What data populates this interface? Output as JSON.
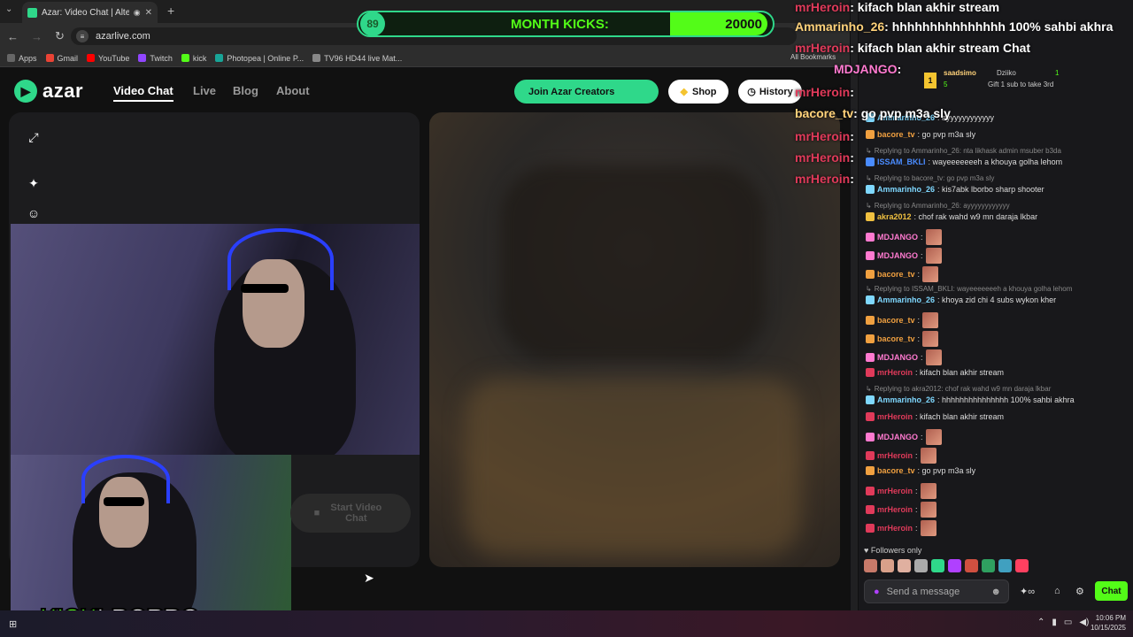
{
  "browser": {
    "tab_title": "Azar: Video Chat | Alternati",
    "url": "azarlive.com",
    "bookmarks": [
      {
        "label": "Apps",
        "color": "#666"
      },
      {
        "label": "Gmail",
        "color": "#ea4335"
      },
      {
        "label": "YouTube",
        "color": "#ff0000"
      },
      {
        "label": "Twitch",
        "color": "#9146ff"
      },
      {
        "label": "kick",
        "color": "#53fc18"
      },
      {
        "label": "Photopea | Online P...",
        "color": "#18a497"
      },
      {
        "label": "TV96 HD44 live Mat...",
        "color": "#888"
      }
    ],
    "all_bookmarks": "All Bookmarks",
    "window_caption": "gle Chrome"
  },
  "azar": {
    "logo": "azar",
    "nav": [
      "Video Chat",
      "Live",
      "Blog",
      "About"
    ],
    "join_creators": "Join Azar Creators",
    "shop": "Shop",
    "history": "History",
    "start_video_chat": "Start Video Chat"
  },
  "overlay": {
    "month_kicks_badge": "89",
    "month_kicks_label": "MONTH KICKS:",
    "month_kicks_value": "20000",
    "lines": [
      {
        "user": "mrHeroin",
        "text": ": kifach blan akhir stream"
      },
      {
        "user": "Ammarinho_26",
        "text": ": hhhhhhhhhhhhhhh 100% sahbi akhra"
      },
      {
        "user": "mrHeroin",
        "text": ": kifach blan akhir stream Chat"
      },
      {
        "user": "MDJANGO",
        "text": ":"
      },
      {
        "user": "mrHeroin",
        "text": ":"
      },
      {
        "user": "bacore_tv",
        "text": ": go pvp m3a sly"
      },
      {
        "user": "mrHeroin",
        "text": ":"
      },
      {
        "user": "mrHeroin",
        "text": ":"
      },
      {
        "user": "mrHeroin",
        "text": ":"
      }
    ]
  },
  "chat": {
    "gift": {
      "user": "saadsimo",
      "sub_count": "5",
      "other": "Dziiko",
      "other_count": "1",
      "caption": "Gift 1 sub to take 3rd",
      "rank": "1"
    },
    "messages": [
      {
        "reply": "",
        "user": "Ammarinho_26",
        "text": ": ayyyyyyyyyyyy",
        "color": "#7fd8ff"
      },
      {
        "reply": "",
        "user": "bacore_tv",
        "text": ": go pvp m3a sly",
        "color": "#f0a040"
      },
      {
        "reply": "Replying to Ammarinho_26: nta likhask admin msuber b3da",
        "user": "ISSAM_BKLI",
        "text": ": wayeeeeeeeh a khouya golha lehom",
        "color": "#4a8cff"
      },
      {
        "reply": "Replying to bacore_tv: go pvp m3a sly",
        "user": "Ammarinho_26",
        "text": ": kis7abk lborbo sharp shooter",
        "color": "#7fd8ff"
      },
      {
        "reply": "Replying to Ammarinho_26: ayyyyyyyyyyyy",
        "user": "akra2012",
        "text": ": chof rak wahd w9 mn daraja lkbar",
        "color": "#f0c040"
      },
      {
        "reply": "",
        "user": "MDJANGO",
        "text": ":",
        "color": "#ff7ad0"
      },
      {
        "reply": "",
        "user": "MDJANGO",
        "text": ":",
        "color": "#ff7ad0"
      },
      {
        "reply": "",
        "user": "bacore_tv",
        "text": ":",
        "color": "#f0a040"
      },
      {
        "reply": "Replying to ISSAM_BKLI: wayeeeeeeeh a khouya golha lehom",
        "user": "Ammarinho_26",
        "text": ": khoya zid chi 4 subs wykon kher",
        "color": "#7fd8ff"
      },
      {
        "reply": "",
        "user": "bacore_tv",
        "text": ":",
        "color": "#f0a040"
      },
      {
        "reply": "",
        "user": "bacore_tv",
        "text": ":",
        "color": "#f0a040"
      },
      {
        "reply": "",
        "user": "MDJANGO",
        "text": ":",
        "color": "#ff7ad0"
      },
      {
        "reply": "",
        "user": "mrHeroin",
        "text": ": kifach blan akhir stream",
        "color": "#e03a5a"
      },
      {
        "reply": "Replying to akra2012: chof rak wahd w9 mn daraja lkbar",
        "user": "Ammarinho_26",
        "text": ": hhhhhhhhhhhhhhh 100% sahbi akhra",
        "color": "#7fd8ff"
      },
      {
        "reply": "",
        "user": "mrHeroin",
        "text": ": kifach blan akhir stream",
        "color": "#e03a5a"
      },
      {
        "reply": "",
        "user": "MDJANGO",
        "text": ":",
        "color": "#ff7ad0"
      },
      {
        "reply": "",
        "user": "mrHeroin",
        "text": ":",
        "color": "#e03a5a"
      },
      {
        "reply": "",
        "user": "bacore_tv",
        "text": ": go pvp m3a sly",
        "color": "#f0a040"
      },
      {
        "reply": "",
        "user": "mrHeroin",
        "text": ":",
        "color": "#e03a5a"
      },
      {
        "reply": "",
        "user": "mrHeroin",
        "text": ":",
        "color": "#e03a5a"
      },
      {
        "reply": "",
        "user": "mrHeroin",
        "text": ":",
        "color": "#e03a5a"
      }
    ],
    "followers_only": "Followers only",
    "placeholder": "Send a message",
    "chat_button": "Chat"
  },
  "kick_logo": {
    "brand": "KICK",
    "name": "LBORBO"
  },
  "taskbar": {
    "time": "10:06 PM",
    "date": "10/15/2025"
  },
  "colors": {
    "accent": "#2fd88a",
    "kick_green": "#53fc18",
    "username_red": "#e03a5a"
  }
}
